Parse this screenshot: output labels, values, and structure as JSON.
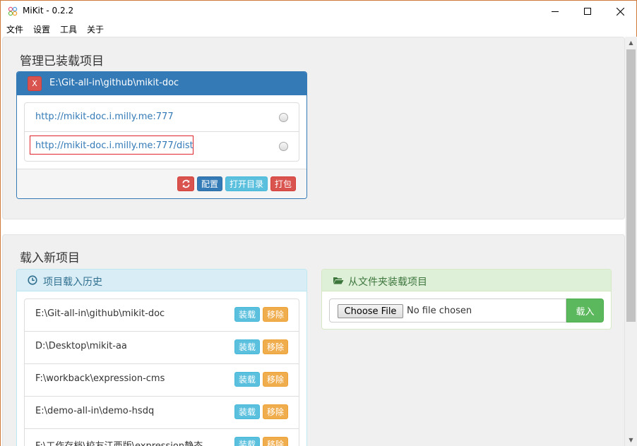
{
  "window": {
    "title": "MiKit - 0.2.2"
  },
  "menu": [
    "文件",
    "设置",
    "工具",
    "关于"
  ],
  "loaded_section": {
    "title": "管理已装载项目",
    "project_path": "E:\\Git-all-in\\github\\mikit-doc",
    "close_label": "X",
    "urls": [
      "http://mikit-doc.i.milly.me:777",
      "http://mikit-doc.i.milly.me:777/dist"
    ],
    "buttons": {
      "config": "配置",
      "open_dir": "打开目录",
      "package": "打包"
    }
  },
  "load_section": {
    "title": "载入新项目",
    "history_title": "项目载入历史",
    "history": [
      "E:\\Git-all-in\\github\\mikit-doc",
      "D:\\Desktop\\mikit-aa",
      "F:\\workback\\expression-cms",
      "E:\\demo-all-in\\demo-hsdq",
      "F:\\工作存档\\校友江西版\\expression静态"
    ],
    "load_label": "装载",
    "remove_label": "移除",
    "folder_title": "从文件夹装载项目",
    "choose_file_label": "Choose File",
    "no_file_text": "No file chosen",
    "import_label": "载入"
  },
  "colors": {
    "primary": "#337ab7",
    "danger": "#d9534f",
    "info": "#5bc0de",
    "warning": "#f0ad4e",
    "success": "#5cb85c"
  }
}
